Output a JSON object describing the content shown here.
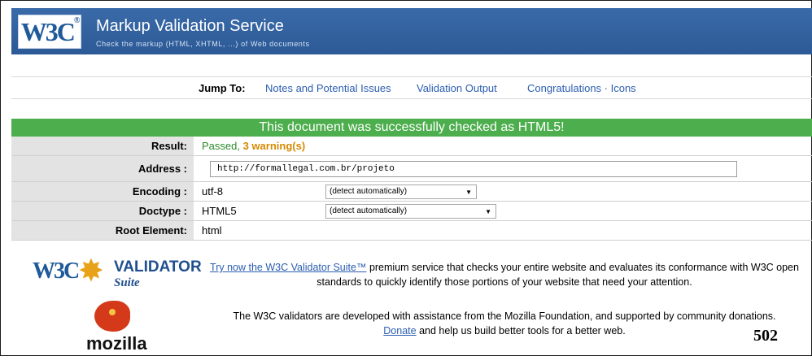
{
  "banner": {
    "logo": "W3C",
    "title": "Markup Validation Service",
    "subtitle": "Check the markup (HTML, XHTML, ...) of Web documents"
  },
  "jump": {
    "label": "Jump To:",
    "links": [
      "Notes and Potential Issues",
      "Validation Output",
      "Congratulations · Icons"
    ]
  },
  "result": {
    "banner": "This document was successfully checked as HTML5!",
    "rows": {
      "result": {
        "label": "Result:",
        "passed": "Passed, ",
        "warnings": "3 warning(s)"
      },
      "address": {
        "label": "Address :",
        "value": "http://formallegal.com.br/projeto"
      },
      "encoding": {
        "label": "Encoding :",
        "value": "utf-8",
        "select": "(detect automatically)"
      },
      "doctype": {
        "label": "Doctype :",
        "value": "HTML5",
        "select": "(detect automatically)"
      },
      "root": {
        "label": "Root Element:",
        "value": "html"
      }
    }
  },
  "promo": {
    "validator_logo": {
      "w3c": "W3C",
      "text": "VALIDATOR",
      "suite": "Suite"
    },
    "suite_link": "Try now the W3C Validator Suite™",
    "suite_text": " premium service that checks your entire website and evaluates its conformance with W3C open standards to quickly identify those portions of your website that need your attention.",
    "mozilla_logo": "mozilla",
    "mozilla_text": "The W3C validators are developed with assistance from the Mozilla Foundation, and supported by community donations.",
    "donate_link": "Donate",
    "donate_text": " and help us build better tools for a better web."
  },
  "page_number": "502",
  "colors": {
    "banner": "#2c5a97",
    "success": "#4cae4c",
    "link": "#2a5db0",
    "warning": "#d68a00"
  }
}
